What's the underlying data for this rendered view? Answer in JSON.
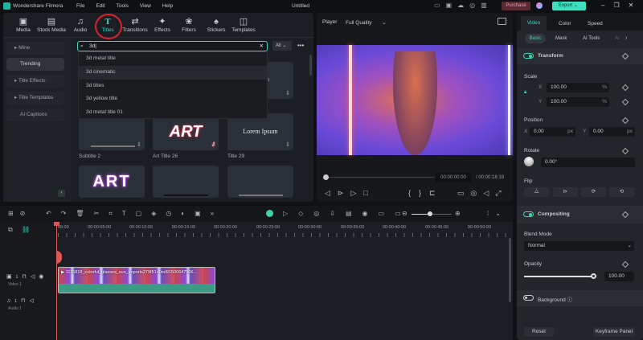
{
  "app": {
    "name": "Wondershare Filmora",
    "project": "Untitled",
    "menu": [
      "File",
      "Edit",
      "Tools",
      "View",
      "Help"
    ],
    "purchase": "Purchase",
    "export": "Export"
  },
  "toolbar": [
    "Media",
    "Stock Media",
    "Audio",
    "Titles",
    "Transitions",
    "Effects",
    "Filters",
    "Stickers",
    "Templates"
  ],
  "sidebar": [
    "Mine",
    "Trending",
    "Title Effects",
    "Title Templates",
    "AI Captions"
  ],
  "search": {
    "value": "3d",
    "filter": "All"
  },
  "suggestions": [
    "3d metal title",
    "3d cinematic",
    "3d titles",
    "3d yellow title",
    "3d metal title 01"
  ],
  "thumbs": [
    {
      "label": "Subtitle 2"
    },
    {
      "label": "Art Title 26",
      "text": "ART"
    },
    {
      "label": "Title 29",
      "text": "Lorem Ipsum"
    },
    {
      "text": "ART"
    }
  ],
  "partial_text": "m",
  "player": {
    "label": "Player",
    "quality": "Full Quality",
    "current": "00:00:00:00",
    "sep": "/",
    "total": "00:00:18:18"
  },
  "right": {
    "tabs": [
      "Video",
      "Color",
      "Speed"
    ],
    "subtabs": [
      "Basic",
      "Mask",
      "AI Tools",
      "Ai"
    ],
    "transform": "Transform",
    "scale": "Scale",
    "sx": "100.00",
    "sy": "100.00",
    "pct": "%",
    "X": "X",
    "Y": "Y",
    "position": "Position",
    "px": "0.00",
    "py": "0.00",
    "unit": "px",
    "rotate": "Rotate",
    "rot": "0.00°",
    "flip": "Flip",
    "compositing": "Compositing",
    "blend_label": "Blend Mode",
    "blend": "Normal",
    "opacity_label": "Opacity",
    "opacity": "100.00",
    "opacity_fraction": 1.0,
    "background": "Background",
    "reset": "Reset",
    "keyframe": "Keyframe Panel"
  },
  "timeline": {
    "ruler": [
      "00:00",
      "00:00:05:00",
      "00:00:10:00",
      "00:00:15:00",
      "00:00:20:00",
      "00:00:25:00",
      "00:00:30:00",
      "00:00:35:00",
      "00:00:40:00",
      "00:00:45:00",
      "00:00:50:00"
    ],
    "clip": "1115818_colorful_glasses_sun_imports279f51d0ed91500647506...",
    "video_track": "Video 1",
    "audio_track": "Audio 1",
    "track_num": "1"
  }
}
